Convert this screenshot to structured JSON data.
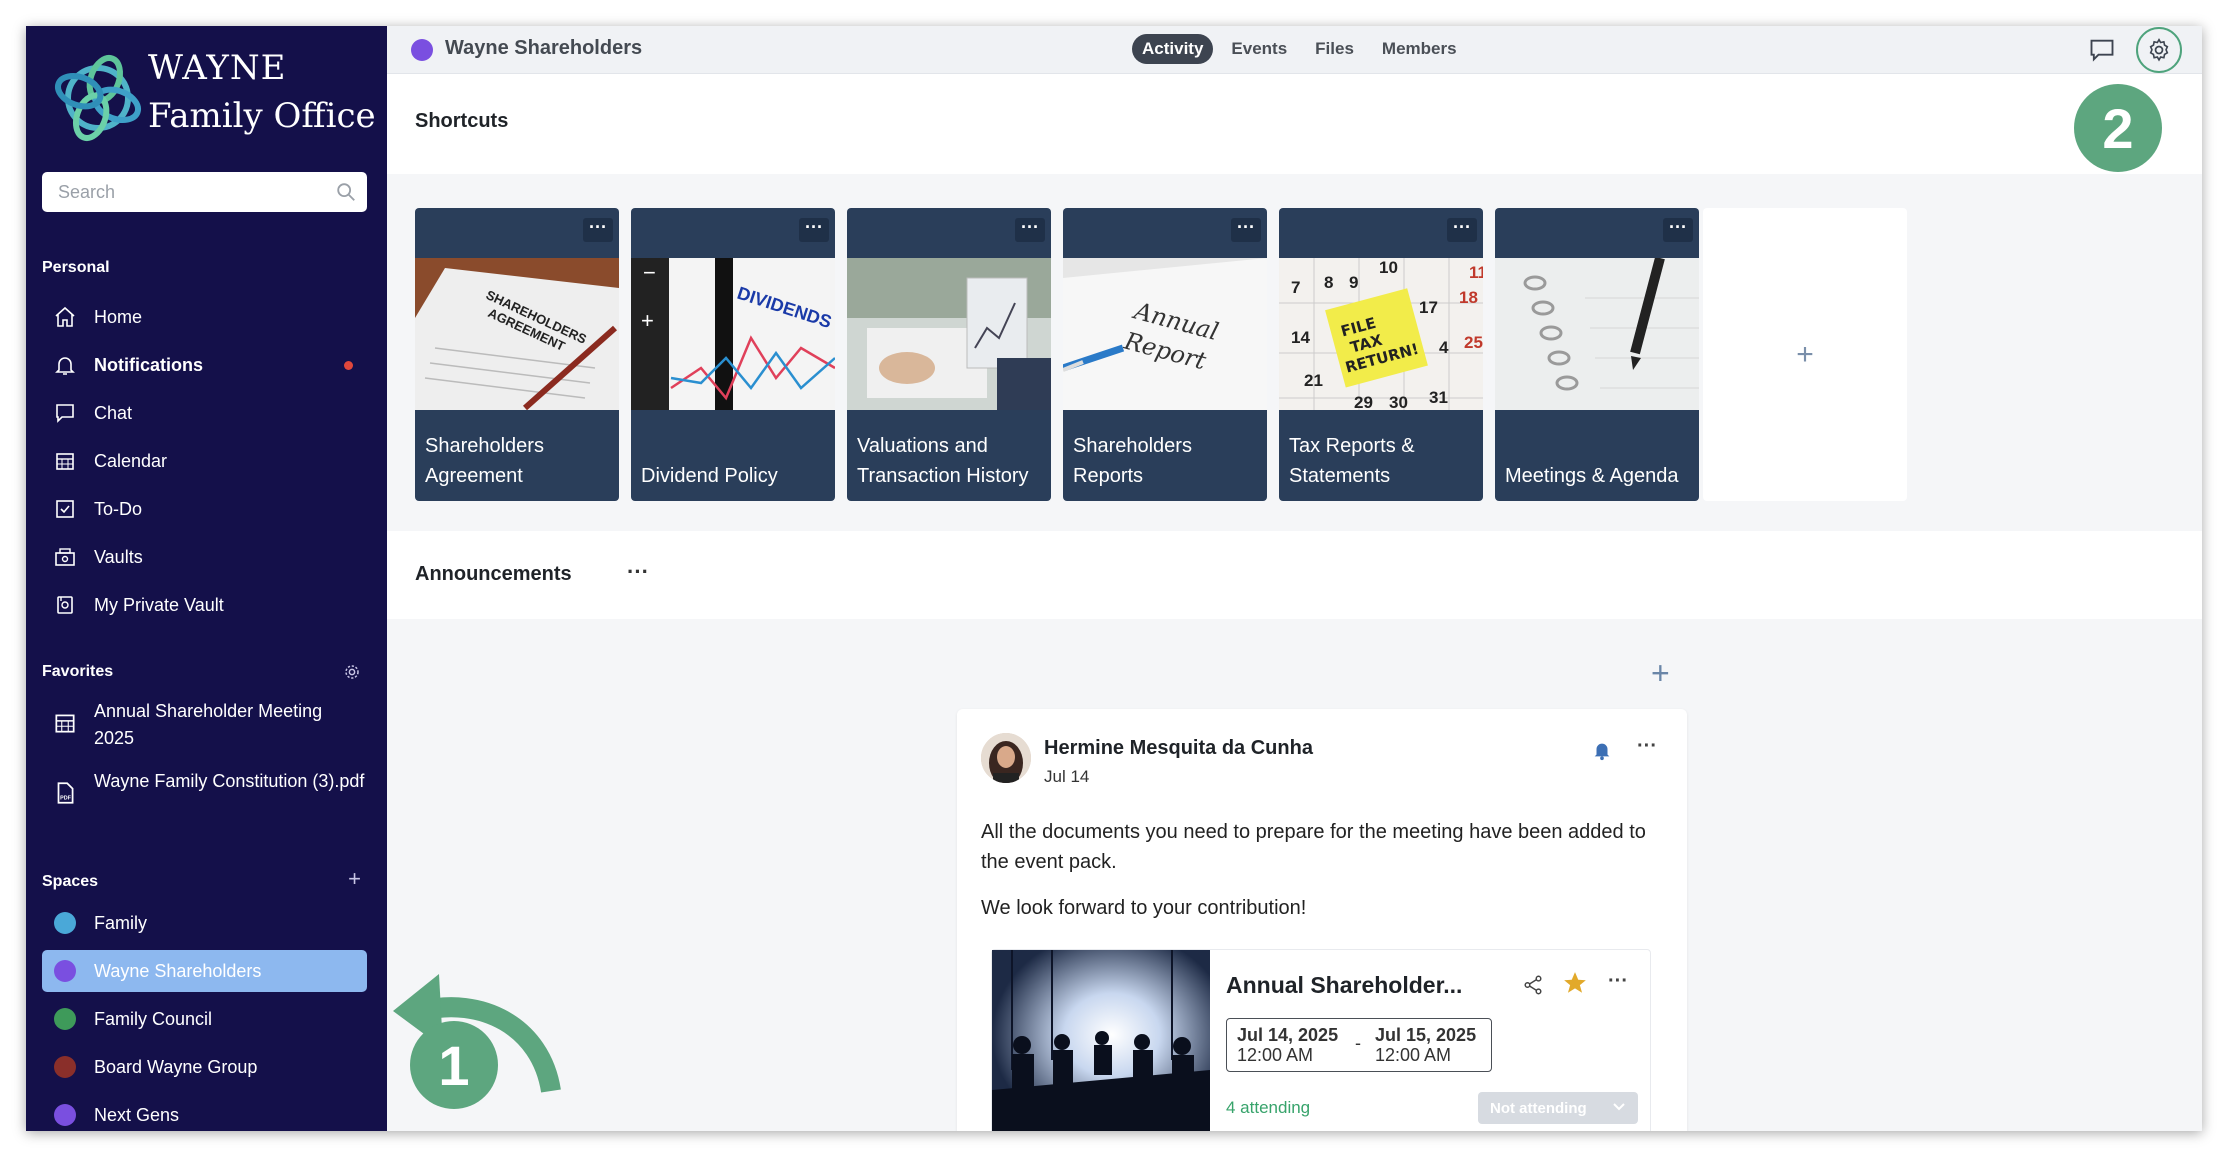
{
  "brand": {
    "line1": "WAYNE",
    "line2": "Family Office"
  },
  "search": {
    "placeholder": "Search"
  },
  "personal": {
    "title": "Personal",
    "items": [
      {
        "label": "Home",
        "icon": "home-icon"
      },
      {
        "label": "Notifications",
        "icon": "bell-icon",
        "unread": true
      },
      {
        "label": "Chat",
        "icon": "chat-icon"
      },
      {
        "label": "Calendar",
        "icon": "calendar-icon"
      },
      {
        "label": "To-Do",
        "icon": "checkbox-icon"
      },
      {
        "label": "Vaults",
        "icon": "vault-icon"
      },
      {
        "label": "My Private Vault",
        "icon": "private-vault-icon"
      }
    ]
  },
  "favorites": {
    "title": "Favorites",
    "items": [
      {
        "label": "Annual Shareholder Meeting 2025",
        "icon": "calendar-icon"
      },
      {
        "label": "Wayne Family Constitution (3).pdf",
        "icon": "pdf-icon"
      }
    ]
  },
  "spaces": {
    "title": "Spaces",
    "items": [
      {
        "label": "Family",
        "color": "#4aa8d8"
      },
      {
        "label": "Wayne Shareholders",
        "color": "#7a4fe0",
        "active": true
      },
      {
        "label": "Family Council",
        "color": "#3e9a5a"
      },
      {
        "label": "Board Wayne Group",
        "color": "#8a2f2a"
      },
      {
        "label": "Next Gens",
        "color": "#7a4fe0"
      }
    ]
  },
  "topbar": {
    "title": "Wayne Shareholders",
    "dot_color": "#7a4fe0",
    "tabs": [
      "Activity",
      "Events",
      "Files",
      "Members"
    ],
    "active_tab": "Activity"
  },
  "shortcuts": {
    "title": "Shortcuts",
    "more_label": "···",
    "add_label": "+",
    "cards": [
      {
        "label": "Shareholders Agreement"
      },
      {
        "label": "Dividend Policy"
      },
      {
        "label": "Valuations and Transaction History"
      },
      {
        "label": "Shareholders Reports"
      },
      {
        "label": "Tax Reports & Statements"
      },
      {
        "label": "Meetings & Agenda"
      }
    ],
    "image_texts": {
      "agreement_line1": "SHAREHOLDERS",
      "agreement_line2": "AGREEMENT",
      "dividends": "DIVIDENDS",
      "report_line1": "Annual",
      "report_line2": "Report",
      "tax_line1": "FILE",
      "tax_line2": "TAX",
      "tax_line3": "RETURN!",
      "cal_numbers": [
        "10",
        "9",
        "8",
        "7",
        "18",
        "17",
        "14",
        "21",
        "29",
        "30",
        "31",
        "25",
        "4",
        "11"
      ]
    }
  },
  "announcements": {
    "title": "Announcements",
    "more_label": "···",
    "add_label": "+",
    "post": {
      "author": "Hermine Mesquita da Cunha",
      "date": "Jul 14",
      "body1": "All the documents you need to prepare for the meeting have been added to the event pack.",
      "body2": "We look forward to your contribution!",
      "more_label": "···",
      "event": {
        "title": "Annual Shareholder...",
        "start_date": "Jul 14, 2025",
        "start_time": "12:00 AM",
        "end_date": "Jul 15, 2025",
        "end_time": "12:00 AM",
        "separator": "-",
        "attending": "4 attending",
        "rsvp": "Not attending",
        "more_label": "···",
        "starred": true,
        "star_color": "#e2a92a"
      }
    }
  },
  "annotations": {
    "badge1": "1",
    "badge2": "2",
    "color": "#5da67f"
  }
}
